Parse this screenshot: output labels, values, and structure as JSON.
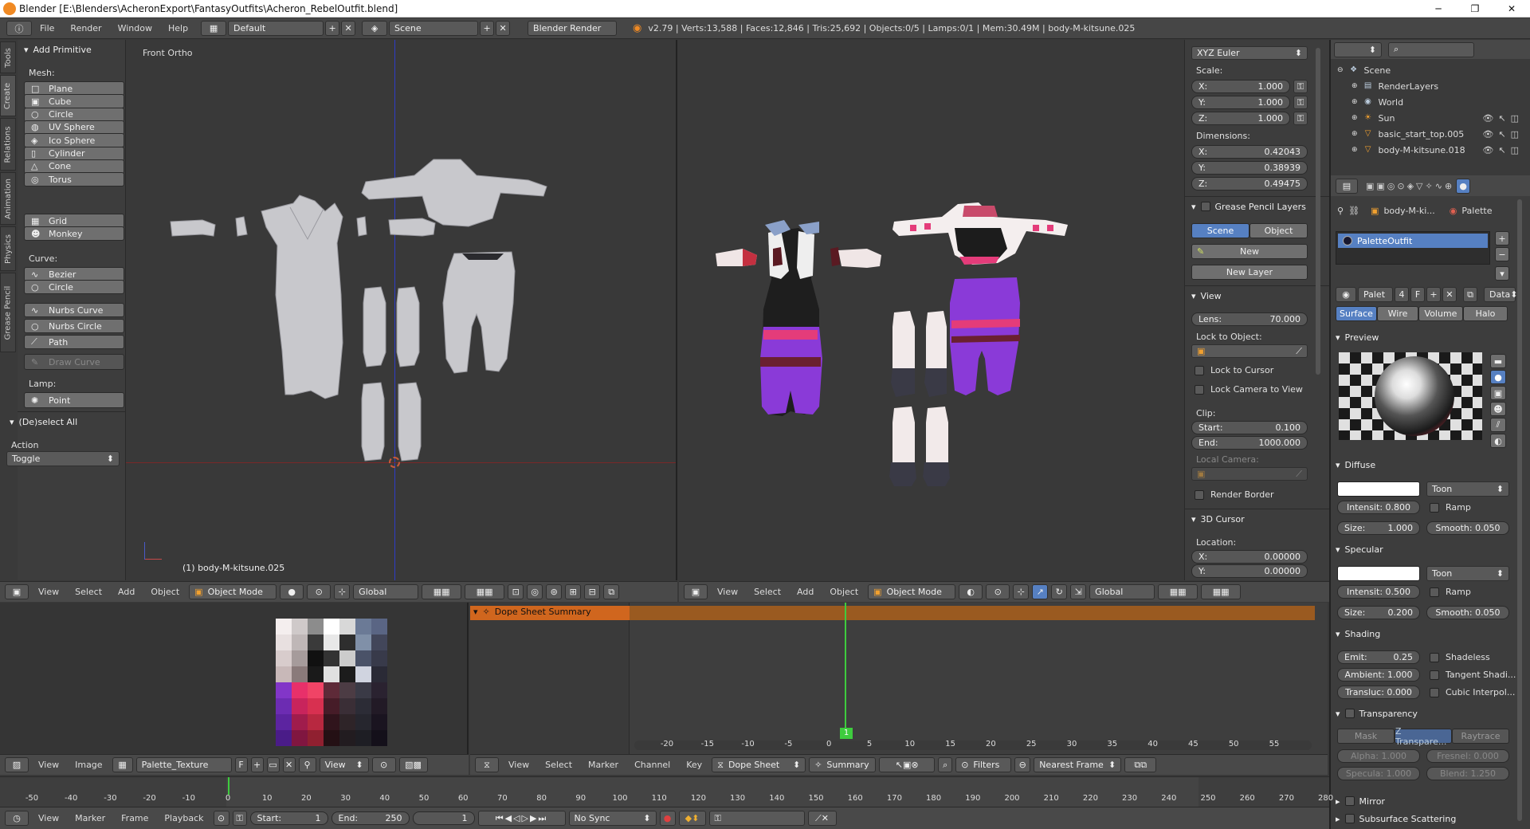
{
  "titlebar": {
    "title": "Blender [E:\\Blenders\\AcheronExport\\FantasyOutfits\\Acheron_RebelOutfit.blend]",
    "minimize": "─",
    "maximize": "❐",
    "close": "✕"
  },
  "info": {
    "menus": [
      "File",
      "Render",
      "Window",
      "Help"
    ],
    "layout": "Default",
    "scene": "Scene",
    "engine": "Blender Render",
    "stats": "v2.79 | Verts:13,588 | Faces:12,846 | Tris:25,692 | Objects:0/5 | Lamps:0/1 | Mem:30.49M | body-M-kitsune.025"
  },
  "tool_tabs": [
    "Tools",
    "Create",
    "Relations",
    "Animation",
    "Physics",
    "Grease Pencil"
  ],
  "toolshelf": {
    "add_primitive": "Add Primitive",
    "mesh_label": "Mesh:",
    "mesh": [
      {
        "label": "Plane",
        "icon": "□"
      },
      {
        "label": "Cube",
        "icon": "▣"
      },
      {
        "label": "Circle",
        "icon": "○"
      },
      {
        "label": "UV Sphere",
        "icon": "◍"
      },
      {
        "label": "Ico Sphere",
        "icon": "◈"
      },
      {
        "label": "Cylinder",
        "icon": "▯"
      },
      {
        "label": "Cone",
        "icon": "△"
      },
      {
        "label": "Torus",
        "icon": "◎"
      }
    ],
    "mesh2": [
      {
        "label": "Grid",
        "icon": "▦"
      },
      {
        "label": "Monkey",
        "icon": "☻"
      }
    ],
    "curve_label": "Curve:",
    "curve": [
      {
        "label": "Bezier",
        "icon": "∿"
      },
      {
        "label": "Circle",
        "icon": "○"
      }
    ],
    "curve2": [
      {
        "label": "Nurbs Curve",
        "icon": "∿"
      },
      {
        "label": "Nurbs Circle",
        "icon": "○"
      },
      {
        "label": "Path",
        "icon": "⟋"
      }
    ],
    "draw_curve": "Draw Curve",
    "lamp_label": "Lamp:",
    "point": "Point",
    "deselect_all": "(De)select All",
    "action_label": "Action",
    "action_value": "Toggle"
  },
  "viewport_left": {
    "view_name": "Front Ortho",
    "object_label": "(1) body-M-kitsune.025"
  },
  "vp_header": {
    "menus": [
      "View",
      "Select",
      "Add",
      "Object"
    ],
    "mode": "Object Mode",
    "orientation": "Global"
  },
  "properties_n": {
    "rotation_mode": "XYZ Euler",
    "scale_label": "Scale:",
    "scale": [
      {
        "axis": "X:",
        "value": "1.000"
      },
      {
        "axis": "Y:",
        "value": "1.000"
      },
      {
        "axis": "Z:",
        "value": "1.000"
      }
    ],
    "dimensions_label": "Dimensions:",
    "dimensions": [
      {
        "axis": "X:",
        "value": "0.42043"
      },
      {
        "axis": "Y:",
        "value": "0.38939"
      },
      {
        "axis": "Z:",
        "value": "0.49475"
      }
    ],
    "grease_pencil": "Grease Pencil Layers",
    "gp_scene": "Scene",
    "gp_object": "Object",
    "gp_new": "New",
    "gp_new_layer": "New Layer",
    "view": "View",
    "lens_label": "Lens:",
    "lens_value": "70.000",
    "lock_to_object": "Lock to Object:",
    "lock_to_cursor": "Lock to Cursor",
    "lock_camera": "Lock Camera to View",
    "clip": "Clip:",
    "clip_start_label": "Start:",
    "clip_start": "0.100",
    "clip_end_label": "End:",
    "clip_end": "1000.000",
    "local_camera": "Local Camera:",
    "render_border": "Render Border",
    "cursor": "3D Cursor",
    "location": "Location:",
    "loc_x_label": "X:",
    "loc_x": "0.00000",
    "loc_y_label": "Y:",
    "loc_y": "0.00000"
  },
  "outliner": {
    "items": [
      {
        "label": "Scene",
        "icon": "❖",
        "indent": 0
      },
      {
        "label": "RenderLayers",
        "icon": "▤",
        "indent": 1
      },
      {
        "label": "World",
        "icon": "◉",
        "indent": 1
      },
      {
        "label": "Sun",
        "icon": "☀",
        "indent": 1
      },
      {
        "label": "basic_start_top.005",
        "icon": "▽",
        "indent": 1
      },
      {
        "label": "body-M-kitsune.018",
        "icon": "▽",
        "indent": 1
      }
    ]
  },
  "material": {
    "breadcrumb_obj": "body-M-ki...",
    "breadcrumb_mat": "Palette",
    "slot_name": "PaletteOutfit",
    "mat_name": "Palet",
    "users": "4",
    "fake": "F",
    "data": "Data",
    "tabs": [
      "Surface",
      "Wire",
      "Volume",
      "Halo"
    ],
    "preview": "Preview",
    "diffuse": "Diffuse",
    "diffuse_shader": "Toon",
    "diffuse_intensity": "Intensit: 0.800",
    "diffuse_ramp": "Ramp",
    "diffuse_size": "Size:",
    "diffuse_size_v": "1.000",
    "diffuse_smooth": "Smooth: 0.050",
    "specular": "Specular",
    "spec_shader": "Toon",
    "spec_intensity": "Intensit: 0.500",
    "spec_ramp": "Ramp",
    "spec_size": "Size:",
    "spec_size_v": "0.200",
    "spec_smooth": "Smooth: 0.050",
    "shading": "Shading",
    "emit": "Emit:",
    "emit_v": "0.25",
    "shadeless": "Shadeless",
    "ambient": "Ambient: 1.000",
    "tangent": "Tangent Shadi...",
    "transluc": "Transluc: 0.000",
    "cubic": "Cubic Interpol...",
    "transparency": "Transparency",
    "t_tabs": [
      "Mask",
      "Z Transpare...",
      "Raytrace"
    ],
    "alpha": "Alpha:  1.000",
    "fresnel": "Fresnel:  0.000",
    "specula": "Specula: 1.000",
    "blend": "Blend:  1.250",
    "mirror": "Mirror",
    "sss": "Subsurface Scattering"
  },
  "image_editor": {
    "menus": [
      "View",
      "Image"
    ],
    "image_name": "Palette_Texture",
    "fake": "F",
    "view": "View"
  },
  "dopesheet": {
    "summary_label": "Dope Sheet Summary",
    "ticks": [
      "-20",
      "-15",
      "-10",
      "-5",
      "0",
      "5",
      "10",
      "15",
      "20",
      "25",
      "30",
      "35",
      "40",
      "45",
      "50",
      "55"
    ],
    "frame_badge": "1",
    "menus": [
      "View",
      "Select",
      "Marker",
      "Channel",
      "Key"
    ],
    "mode": "Dope Sheet",
    "summary_btn": "Summary",
    "filters": "Filters",
    "snap": "Nearest Frame"
  },
  "timeline": {
    "ticks": [
      "-50",
      "-40",
      "-30",
      "-20",
      "-10",
      "0",
      "10",
      "20",
      "30",
      "40",
      "50",
      "60",
      "70",
      "80",
      "90",
      "100",
      "110",
      "120",
      "130",
      "140",
      "150",
      "160",
      "170",
      "180",
      "190",
      "200",
      "210",
      "220",
      "230",
      "240",
      "250",
      "260",
      "270",
      "280"
    ],
    "menus": [
      "View",
      "Marker",
      "Frame",
      "Playback"
    ],
    "start_label": "Start:",
    "start": "1",
    "end_label": "End:",
    "end": "250",
    "current": "1",
    "sync": "No Sync"
  },
  "palette_colors": [
    [
      "#f4eeee",
      "#cfc9c9",
      "#8c8c8c",
      "#ffffff",
      "#d8d8d8",
      "#6b7a96",
      "#5a6584"
    ],
    [
      "#e8e0e0",
      "#bfb7b7",
      "#3a3a3a",
      "#e8e8e8",
      "#2e2e2e",
      "#8090a8",
      "#42465a"
    ],
    [
      "#d8cccc",
      "#a69b9b",
      "#111111",
      "#333333",
      "#cccccc",
      "#4a5268",
      "#383a4a"
    ],
    [
      "#c8b8b8",
      "#8a7a7a",
      "#1a1a1a",
      "#e0e0e0",
      "#1c1c1c",
      "#d0d4e0",
      "#2a2a36"
    ],
    [
      "#8236c8",
      "#e8306a",
      "#f04466",
      "#5e2a38",
      "#4c3c44",
      "#3a3a46",
      "#2a2230"
    ],
    [
      "#6c2cb2",
      "#c8245c",
      "#d83050",
      "#461c28",
      "#3a2e36",
      "#2c2c36",
      "#221a26"
    ],
    [
      "#5c24a0",
      "#a01c4c",
      "#b82840",
      "#30141c",
      "#2e2428",
      "#26262e",
      "#1a1420"
    ],
    [
      "#4a1c88",
      "#801640",
      "#902030",
      "#241014",
      "#221c20",
      "#1e1e24",
      "#14101a"
    ]
  ]
}
